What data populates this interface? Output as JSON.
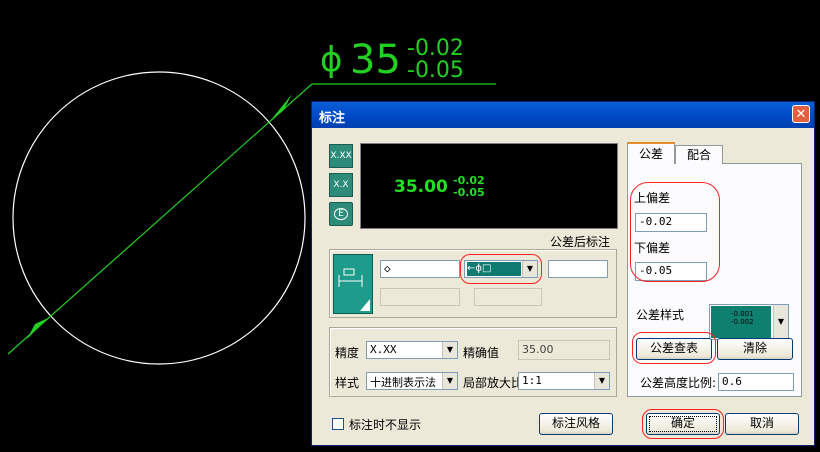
{
  "cad": {
    "dimension": {
      "symbol": "ϕ",
      "value": "35",
      "upper": "-0.02",
      "lower": "-0.05"
    }
  },
  "dialog": {
    "title": "标注",
    "close_icon": "close-icon",
    "preview": {
      "value": "35.00",
      "upper": "-0.02",
      "lower": "-0.05"
    },
    "side_icons": [
      "X.XX",
      "X.X",
      "E"
    ],
    "suffix_label": "公差后标注",
    "symbol_input": "◇",
    "frame_combo": "←ϕ□",
    "precision": {
      "label": "精度",
      "value": "X.XX"
    },
    "exact": {
      "label": "精确值",
      "value": "35.00"
    },
    "style": {
      "label": "样式",
      "value": "十进制表示法"
    },
    "scale": {
      "label": "局部放大比例",
      "value": "1:1"
    },
    "tabs": [
      "公差",
      "配合"
    ],
    "upper_dev": {
      "label": "上偏差",
      "value": "-0.02"
    },
    "lower_dev": {
      "label": "下偏差",
      "value": "-0.05"
    },
    "tol_style": {
      "label": "公差样式",
      "sample_top": "-0.001",
      "sample_bottom": "-0.002"
    },
    "lookup_button": "公差查表",
    "clear_button": "清除",
    "height_ratio": {
      "label": "公差高度比例:",
      "value": "0.6"
    },
    "hide_checkbox": "标注时不显示",
    "style_button": "标注风格",
    "ok_button": "确定",
    "cancel_button": "取消",
    "accent_color": "#0a5fd8",
    "annotation_color": "#ff2020"
  }
}
